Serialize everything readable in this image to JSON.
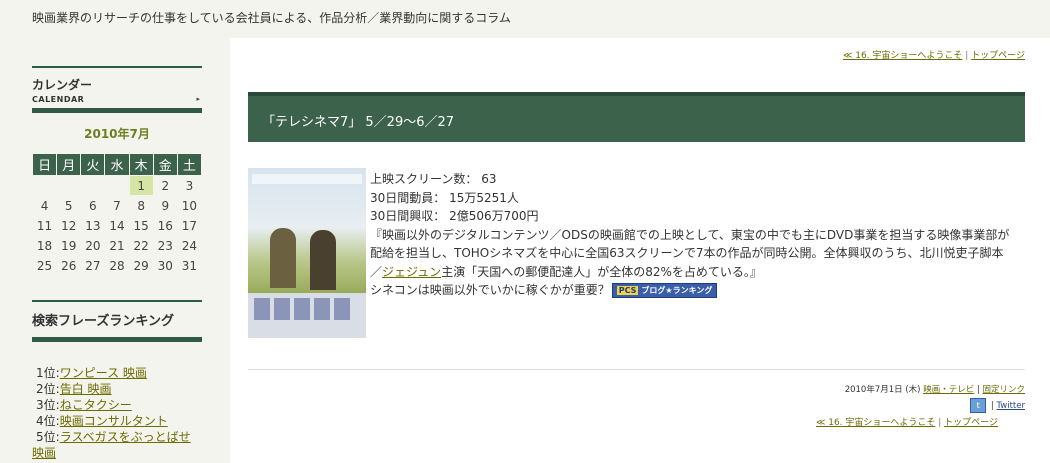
{
  "site": {
    "description": "映画業界のリサーチの仕事をしている会社員による、作品分析／業界動向に関するコラム"
  },
  "calendar": {
    "title": "カレンダー",
    "subtitle": "CALENDAR",
    "arrow": "▸",
    "month": "2010年7月",
    "weekdays": [
      "日",
      "月",
      "火",
      "水",
      "木",
      "金",
      "土"
    ],
    "weeks": [
      [
        "",
        "",
        "",
        "",
        "1",
        "2",
        "3"
      ],
      [
        "4",
        "5",
        "6",
        "7",
        "8",
        "9",
        "10"
      ],
      [
        "11",
        "12",
        "13",
        "14",
        "15",
        "16",
        "17"
      ],
      [
        "18",
        "19",
        "20",
        "21",
        "22",
        "23",
        "24"
      ],
      [
        "25",
        "26",
        "27",
        "28",
        "29",
        "30",
        "31"
      ]
    ],
    "highlight": "1"
  },
  "ranking": {
    "title": "検索フレーズランキング",
    "items": [
      {
        "rank": "1位:",
        "label": "ワンピース 映画"
      },
      {
        "rank": "2位:",
        "label": "告白 映画"
      },
      {
        "rank": "3位:",
        "label": "ねこタクシー"
      },
      {
        "rank": "4位:",
        "label": "映画コンサルタント"
      },
      {
        "rank": "5位:",
        "label": "ラスベガスをぶっとばせ"
      }
    ],
    "item5_wrap": "映画"
  },
  "nav": {
    "prev": "≪ 16. 宇宙ショーへようこそ",
    "sep": " | ",
    "top": "トップページ"
  },
  "entry": {
    "title": "「テレシネマ7」 5／29〜6／27",
    "lines": [
      "上映スクリーン数： 63",
      "30日間動員： 15万5251人",
      "30日間興収： 2億506万700円",
      "『映画以外のデジタルコンテンツ／ODSの映画館での上映として、東宝の中でも主にDVD事業を担当する映像事業部が",
      "配給を担当し、TOHOシネマズを中心に全国63スクリーンで7本の作品が同時公開。全体興収のうち、北川悦吏子脚本"
    ],
    "line6_prefix": "／",
    "line6_link": "ジェジュン",
    "line6_suffix": "主演「天国への郵便配達人」が全体の82%を占めている。』",
    "line7": "シネコンは映画以外でいかに稼ぐかが重要？",
    "badge_pc": "PCS",
    "badge_label": "ブログ★ランキング"
  },
  "meta": {
    "date": "2010年7月1日 (木) ",
    "category": "映画・テレビ",
    "permalink": "固定リンク",
    "twitter": "Twitter",
    "twitter_icon": "t"
  }
}
